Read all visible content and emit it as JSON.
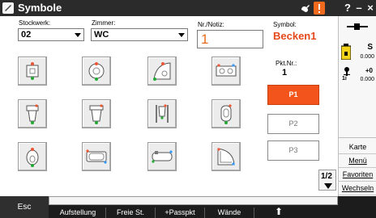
{
  "window": {
    "title": "Symbole",
    "help": "?",
    "minimize": "–",
    "close": "×"
  },
  "form": {
    "floor_label": "Stockwerk:",
    "floor_value": "02",
    "room_label": "Zimmer:",
    "room_value": "WC",
    "note_label": "Nr./Notiz:",
    "note_value": "1",
    "symbol_label": "Symbol:",
    "symbol_value": "Becken1",
    "point_label": "Pkt.Nr.:",
    "point_value": "1"
  },
  "symbols": [
    {
      "icon": "square-washbasin-icon"
    },
    {
      "icon": "round-washbasin-icon"
    },
    {
      "icon": "corner-washbasin-icon"
    },
    {
      "icon": "double-washbasin-icon"
    },
    {
      "icon": "toilet-icon"
    },
    {
      "icon": "wall-hung-toilet-icon"
    },
    {
      "icon": "wall-urinal-icon"
    },
    {
      "icon": "urinal-icon"
    },
    {
      "icon": "bidet-icon"
    },
    {
      "icon": "bathtub-icon"
    },
    {
      "icon": "bathtub-side-icon"
    },
    {
      "icon": "corner-shower-icon"
    }
  ],
  "points": [
    {
      "label": "P1",
      "active": true
    },
    {
      "label": "P2",
      "active": false
    },
    {
      "label": "P3",
      "active": false
    }
  ],
  "page_indicator": {
    "label": "1/2"
  },
  "status": {
    "battery_label": "S",
    "battery_value": "0.000",
    "sensor_label": "+0",
    "sensor_value": "0.000",
    "sensor_prefix": "1i"
  },
  "side_buttons": [
    {
      "label": "Karte"
    },
    {
      "label": "Menü"
    },
    {
      "label": "Favoriten"
    },
    {
      "label": "Wechseln"
    }
  ],
  "bottom": {
    "esc": "Esc",
    "buttons": [
      "Aufstellung",
      "Freie St.",
      "+Passpkt",
      "Wände",
      "⬆"
    ]
  },
  "colors": {
    "accent": "#f2541b",
    "symbol_text": "#e5481b",
    "note_text": "#e86b1b",
    "titlebar": "#2b2b2b"
  }
}
